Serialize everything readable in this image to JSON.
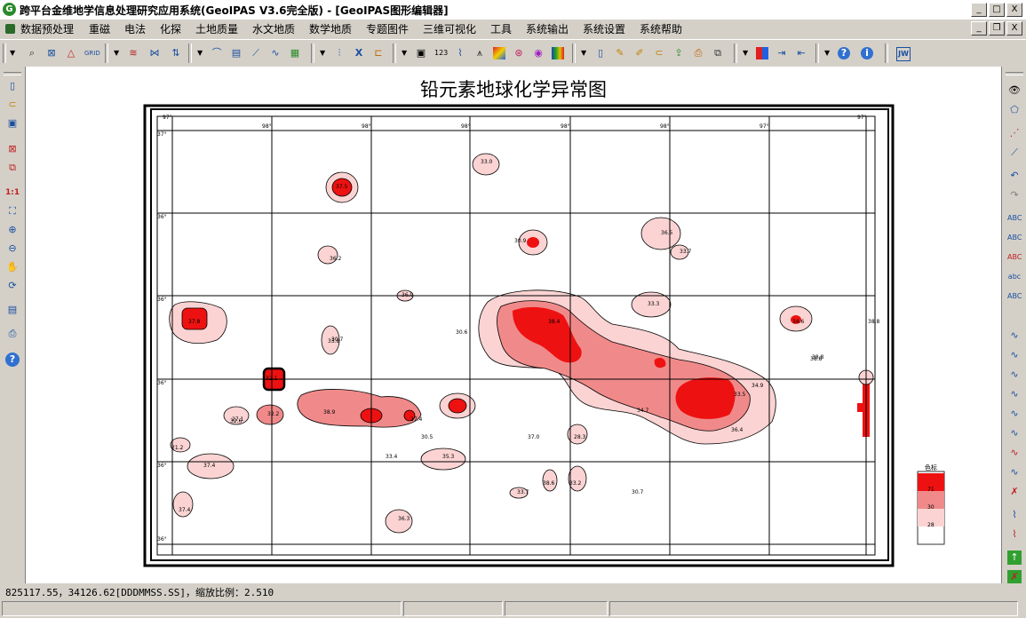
{
  "window": {
    "app_icon": "G",
    "title": "跨平台金维地学信息处理研究应用系统(GeoIPAS V3.6完全版) - [GeoIPAS图形编辑器]",
    "controls": {
      "minimize": "_",
      "maximize": "□",
      "close": "X"
    }
  },
  "menu": {
    "items": [
      "数据预处理",
      "重磁",
      "电法",
      "化探",
      "土地质量",
      "水文地质",
      "数学地质",
      "专题图件",
      "三维可视化",
      "工具",
      "系统输出",
      "系统设置",
      "系统帮助"
    ]
  },
  "mdi_controls": {
    "minimize": "_",
    "restore": "❐",
    "close": "X"
  },
  "toolbar": {
    "icons": [
      "contour-icon",
      "grid-search-icon",
      "triangle-icon",
      "grid-label-icon",
      "wave-icon",
      "filter-icon",
      "sort-icon",
      "profile-icon",
      "surface-icon",
      "fault-icon",
      "hist-icon",
      "map-icon",
      "formula-icon",
      "sigma-icon",
      "table-icon",
      "frame-icon",
      "number-icon",
      "curve-icon",
      "anomaly-icon",
      "color-icon",
      "blob-icon",
      "sphere-icon",
      "palette-icon",
      "calc-icon",
      "pen-icon",
      "edit-icon",
      "open-icon",
      "export-icon",
      "print-icon",
      "copy-icon",
      "legend-icon",
      "import-icon",
      "export-file-icon",
      "help-icon",
      "info-icon",
      "jw-icon"
    ],
    "grid_label": "GRID",
    "jw_label": "JW"
  },
  "map": {
    "title": "铅元素地球化学异常图",
    "colors": {
      "high": "#ee1111",
      "mid": "#f08a8a",
      "low": "#fbd3d3",
      "line": "#000000"
    },
    "grid_labels": {
      "lon": [
        "97°",
        "98°",
        "98°",
        "98°",
        "98°",
        "98°",
        "97°",
        "97°"
      ],
      "lat": [
        "37°",
        "36°",
        "36°",
        "36°",
        "36°",
        "36°"
      ]
    },
    "point_labels": [
      "33.0",
      "37.5",
      "30.9",
      "36.5",
      "33.7",
      "36.2",
      "36.0",
      "33.3",
      "38.4",
      "34.6",
      "38.8",
      "37.8",
      "30.6",
      "30.7",
      "38.8",
      "32.1",
      "34.9",
      "33.5",
      "34.7",
      "38.9",
      "27.1",
      "32.2",
      "27.4",
      "36.4",
      "30.5",
      "37.0",
      "28.3",
      "21.2",
      "33.4",
      "35.3",
      "37.4",
      "38.6",
      "33.2",
      "33.7",
      "30.7",
      "37.4",
      "36.3",
      "38.8",
      "33.8",
      "32.6"
    ],
    "legend": {
      "title": "色标",
      "values": [
        "71",
        "30",
        "28"
      ]
    }
  },
  "status": {
    "coords": "825117.55，34126.62[DDDMMSS.SS]，缩放比例：2.510"
  }
}
